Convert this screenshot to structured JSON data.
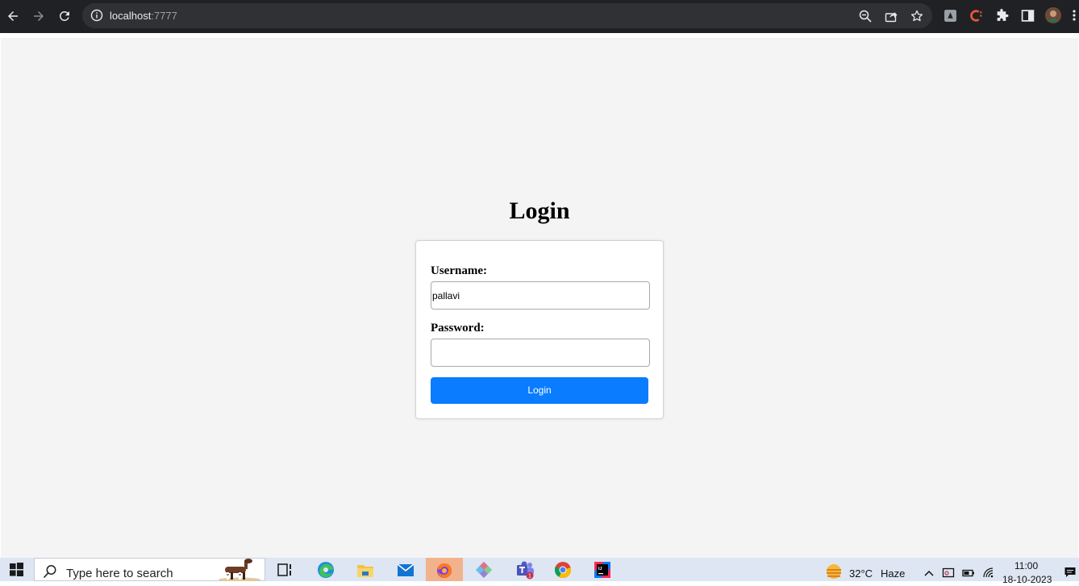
{
  "browser": {
    "url_host": "localhost",
    "url_port": ":7777",
    "icons": [
      "back-icon",
      "forward-icon",
      "reload-icon",
      "site-info-icon",
      "zoom-icon",
      "share-icon",
      "bookmark-star-icon",
      "extension-puzzle-icon",
      "side-panel-icon",
      "profile-avatar"
    ]
  },
  "page": {
    "title": "Login",
    "form": {
      "username_label": "Username:",
      "username_value": "pallavi",
      "password_label": "Password:",
      "password_value": "",
      "submit_label": "Login"
    },
    "colors": {
      "background": "#f4f4f4",
      "card": "#ffffff",
      "button": "#0a7cff"
    }
  },
  "taskbar": {
    "search_placeholder": "Type here to search",
    "apps": [
      "task-view",
      "edge",
      "file-explorer",
      "mail",
      "firefox",
      "app-diamond",
      "teams",
      "chrome",
      "intellij"
    ],
    "teams_badge": "1",
    "weather_temp": "32°C",
    "weather_desc": "Haze",
    "time": "11:00",
    "date": "18-10-2023"
  }
}
